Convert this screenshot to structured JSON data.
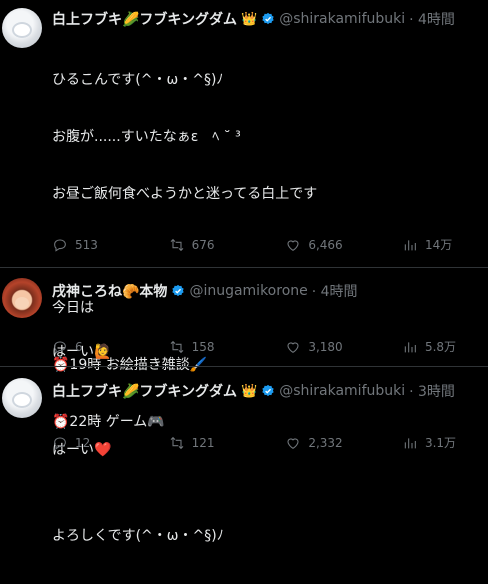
{
  "tweets": [
    {
      "name": "白上フブキ🌽フブキングダム",
      "crown": "👑",
      "handle": "@shirakamifubuki",
      "time": "· 4時間",
      "lines": [
        "ひるこんです(^・ω・^§)ﾉ",
        "お腹が......すいたなぁε　ﾍ ˘ ³",
        "お昼ご飯何食べようかと迷ってる白上です",
        "",
        "今日は",
        "⏰19時 お絵描き雑談🖌️",
        "⏰22時 ゲーム🎮",
        "",
        "よろしくです(^・ω・^§)ﾉ"
      ],
      "replies": "513",
      "retweets": "676",
      "likes": "6,466",
      "views": "14万"
    },
    {
      "name": "戌神ころね🥐本物",
      "handle": "@inugamikorone",
      "time": "· 4時間",
      "lines": [
        "はーい🙋"
      ],
      "replies": "6",
      "retweets": "158",
      "likes": "3,180",
      "views": "5.8万"
    },
    {
      "name": "白上フブキ🌽フブキングダム",
      "crown": "👑",
      "handle": "@shirakamifubuki",
      "time": "· 3時間",
      "lines": [
        "はーい❤️"
      ],
      "replies": "12",
      "retweets": "121",
      "likes": "2,332",
      "views": "3.1万"
    }
  ],
  "icons": {
    "verified": "verified-badge-icon",
    "reply": "reply-icon",
    "retweet": "retweet-icon",
    "like": "heart-icon",
    "views": "views-bar-icon",
    "more": "more-dots-icon"
  },
  "colors": {
    "background": "#000000",
    "text": "#e7e9ea",
    "muted": "#71767b",
    "verified": "#1d9bf0"
  }
}
